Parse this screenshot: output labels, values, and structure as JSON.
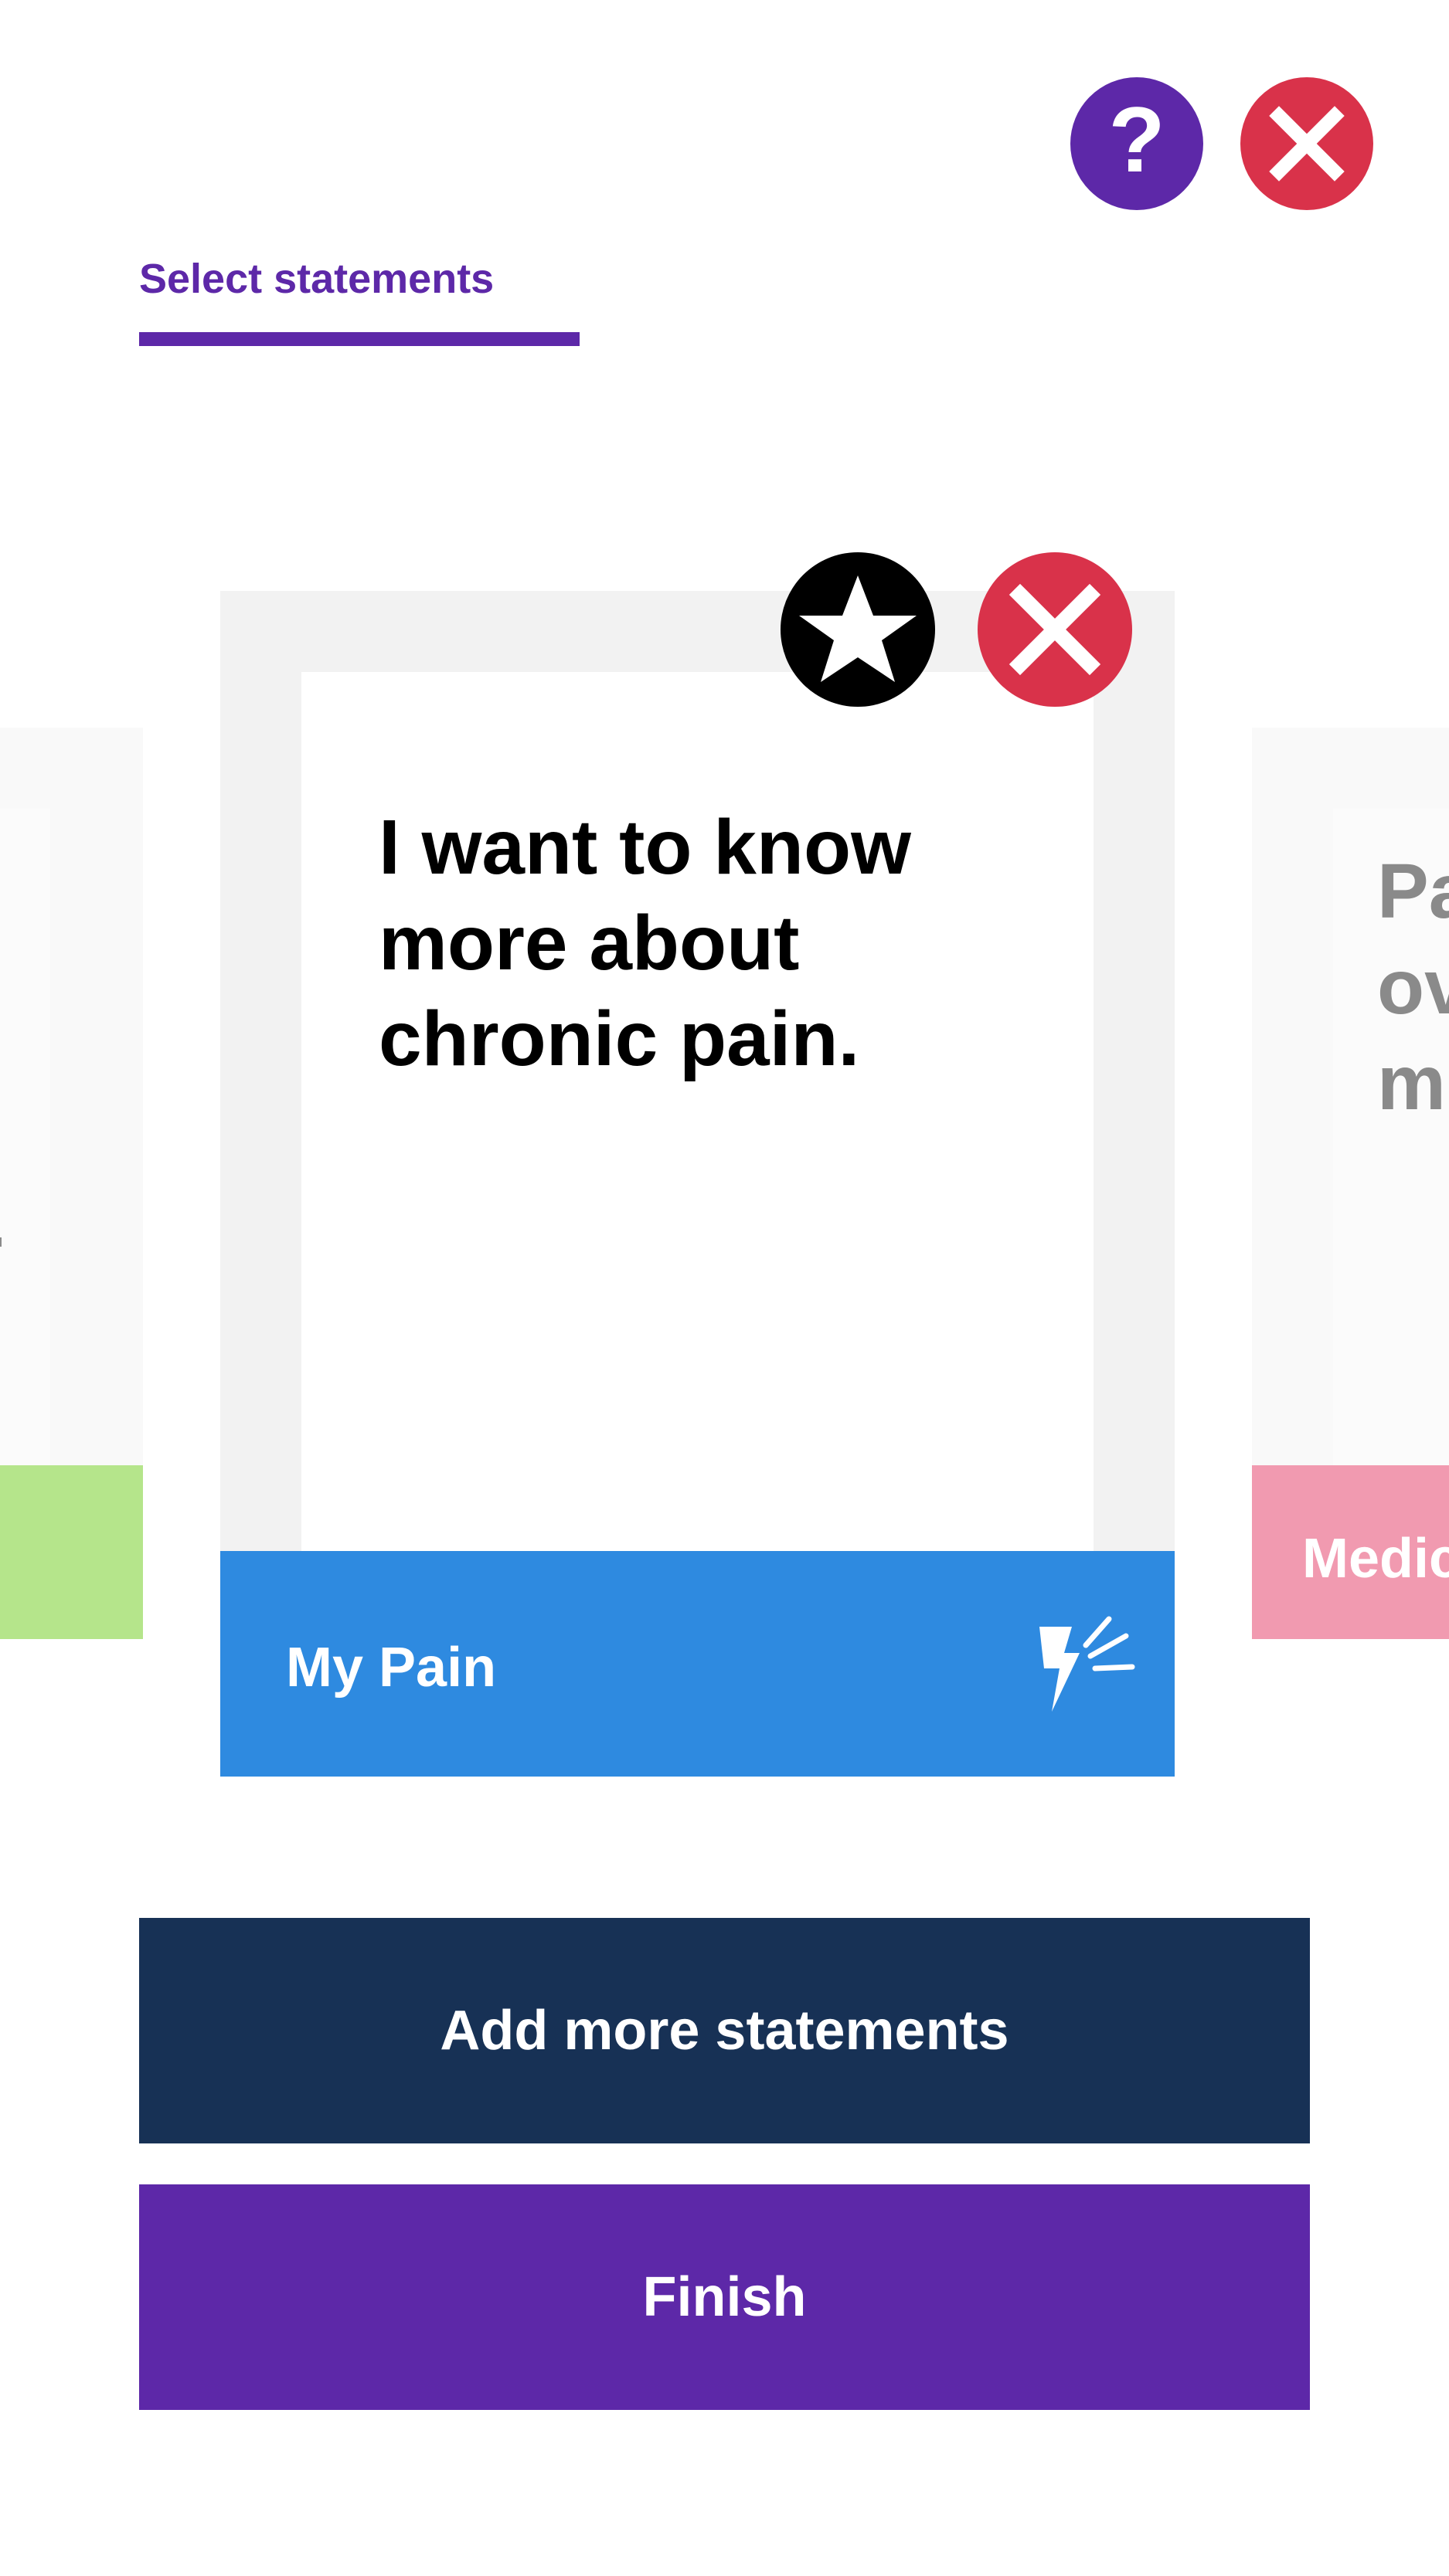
{
  "header": {
    "help_symbol": "?",
    "help_icon": "question-mark-icon",
    "close_icon": "close-icon",
    "tab_label": "Select statements"
  },
  "cards": {
    "left": {
      "category_color": "#b5e58b"
    },
    "current": {
      "statement": "I want to know more about chronic pain.",
      "category": "My Pain",
      "category_color": "#2e8ae0",
      "category_icon": "lightning-bolt-icon",
      "star_icon": "star-icon",
      "remove_icon": "close-icon"
    },
    "right": {
      "statement_visible": [
        "Pa",
        "ov",
        "m"
      ],
      "category": "Medic",
      "category_color": "#f19ab0"
    }
  },
  "actions": {
    "add_more_label": "Add more statements",
    "finish_label": "Finish"
  },
  "colors": {
    "accent_purple": "#5d28a8",
    "danger_red": "#d9324a",
    "navy": "#173155"
  }
}
